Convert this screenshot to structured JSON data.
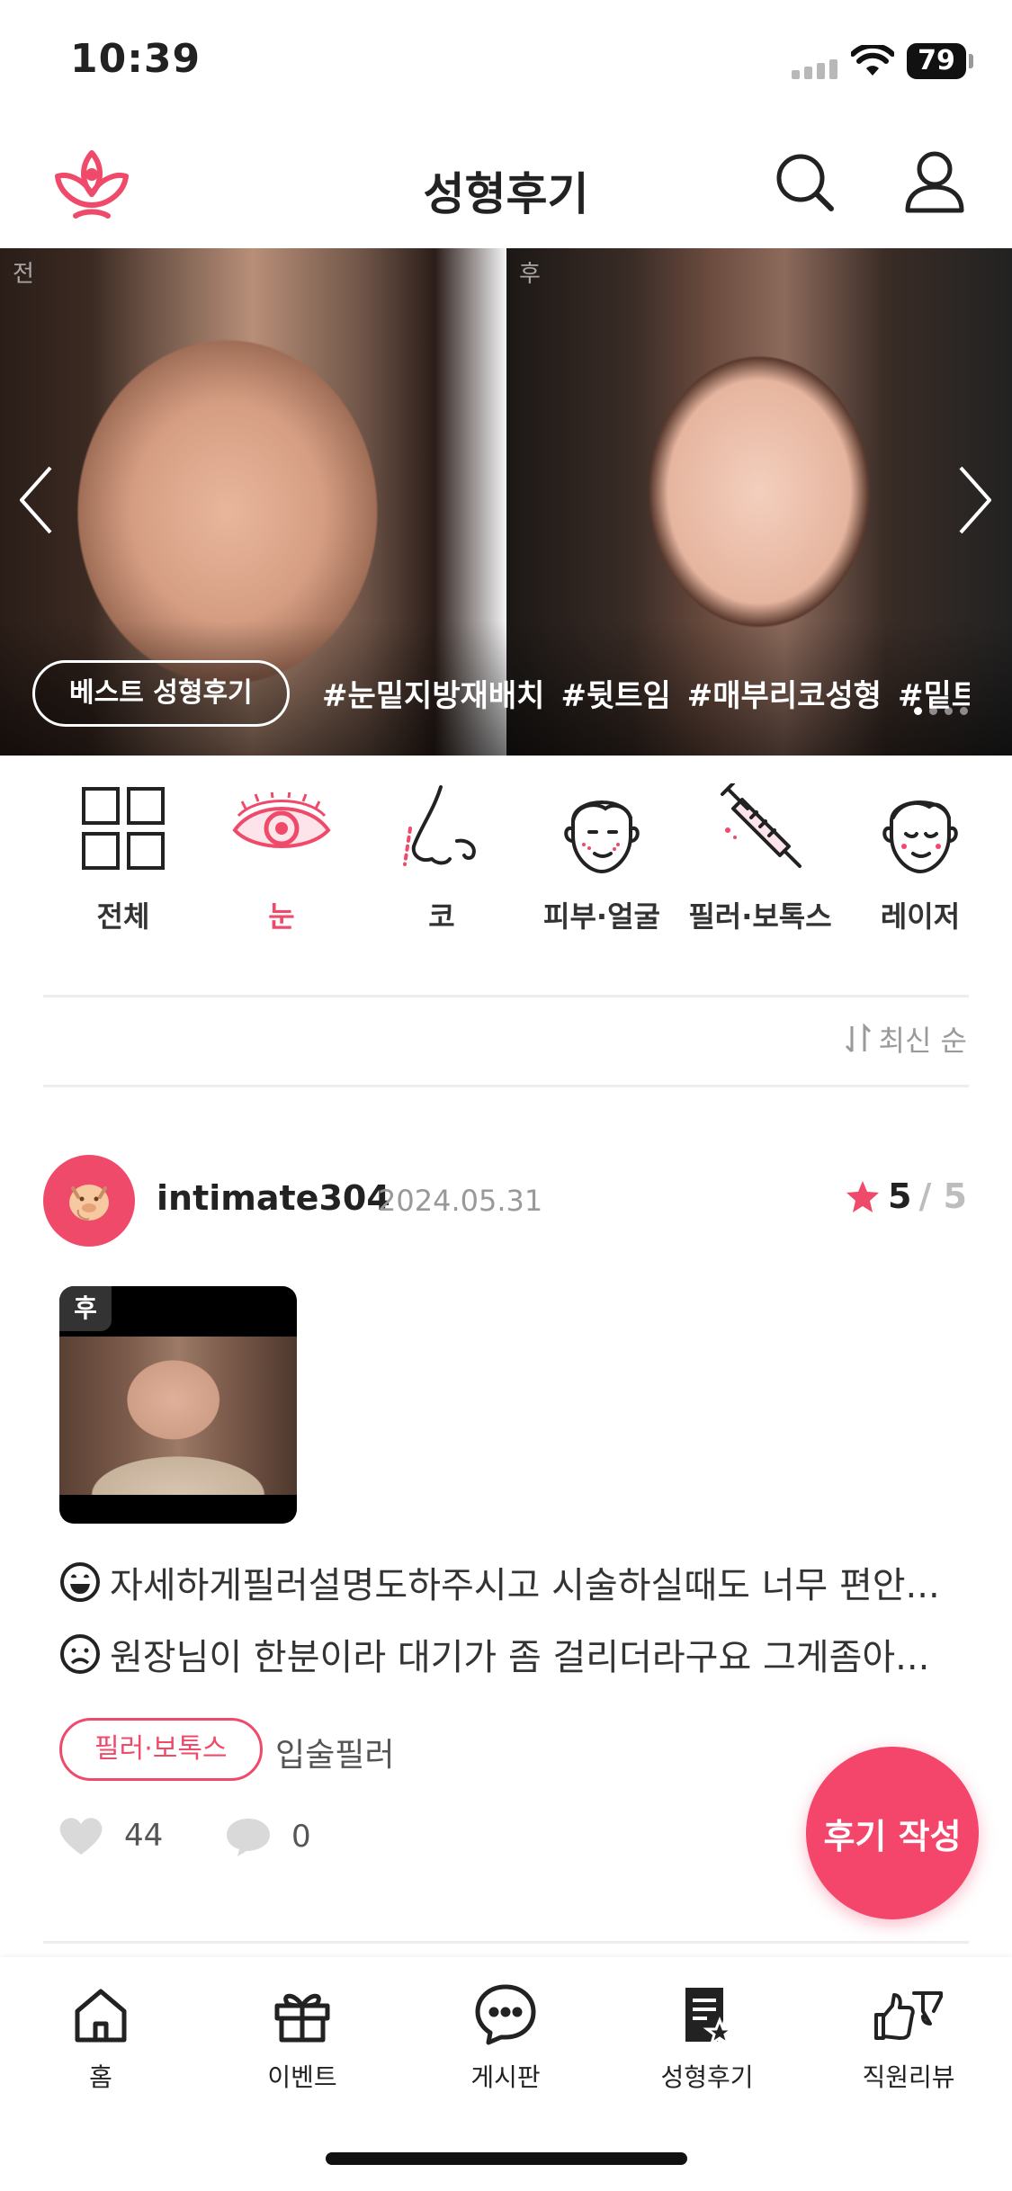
{
  "status_bar": {
    "time": "10:39",
    "battery": "79"
  },
  "header": {
    "title": "성형후기"
  },
  "banner": {
    "before_label": "전",
    "after_label": "후",
    "best_button": "베스트 성형후기",
    "hashtags": [
      "#눈밑지방재배치",
      "#뒷트임",
      "#매부리코성형",
      "#밑트"
    ]
  },
  "categories": [
    {
      "label": "전체",
      "icon": "grid-icon"
    },
    {
      "label": "눈",
      "icon": "eye-icon",
      "active": true
    },
    {
      "label": "코",
      "icon": "nose-icon"
    },
    {
      "label": "피부·얼굴",
      "icon": "face-icon"
    },
    {
      "label": "필러·보톡스",
      "icon": "syringe-icon"
    },
    {
      "label": "레이저",
      "icon": "laser-face-icon"
    }
  ],
  "sort_label": "최신 순",
  "review": {
    "username": "intimate304",
    "date": "2024.05.31",
    "score": "5",
    "score_total": "/ 5",
    "image_badge": "후",
    "positive": "자세하게필러설명도하주시고 시술하실때도 너무 편안...",
    "negative": "원장님이 한분이라 대기가 좀 걸리더라구요 그게좀아...",
    "category_chip": "필러·보톡스",
    "subcategory": "입술필러",
    "likes": "44",
    "comments": "0"
  },
  "fab_label": "후기 작성",
  "bottom_nav": [
    {
      "label": "홈",
      "icon": "home-icon"
    },
    {
      "label": "이벤트",
      "icon": "gift-icon"
    },
    {
      "label": "게시판",
      "icon": "chat-icon"
    },
    {
      "label": "성형후기",
      "icon": "review-doc-icon",
      "active": true
    },
    {
      "label": "직원리뷰",
      "icon": "thumbs-icon"
    }
  ],
  "colors": {
    "accent": "#ef4a6a",
    "fab": "#f4456a"
  }
}
